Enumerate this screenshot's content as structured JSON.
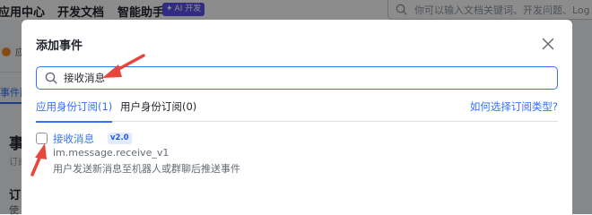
{
  "topbar": {
    "nav": [
      "应用中心",
      "开发文档",
      "智能助手"
    ],
    "ai_badge": "AI 开发",
    "search_placeholder": "你可以输入文档关键词、开发问题、Log ID、"
  },
  "background": {
    "warning_text": "应",
    "tab_label": "事件配",
    "heading": "事",
    "sub": "订阅",
    "heading2": "订",
    "sub2": "使"
  },
  "modal": {
    "title": "添加事件",
    "search_value": "接收消息",
    "tabs": [
      {
        "label": "应用身份订阅(1)",
        "active": true
      },
      {
        "label": "用户身份订阅(0)",
        "active": false
      }
    ],
    "help_link": "如何选择订阅类型?",
    "event": {
      "name": "接收消息",
      "version": "v2.0",
      "key": "im.message.receive_v1",
      "description": "用户发送新消息至机器人或群聊后推送事件",
      "checked": false
    }
  },
  "colors": {
    "primary": "#3370ff",
    "annotation": "#e8453c",
    "ai_badge": "#5b4ff0"
  }
}
